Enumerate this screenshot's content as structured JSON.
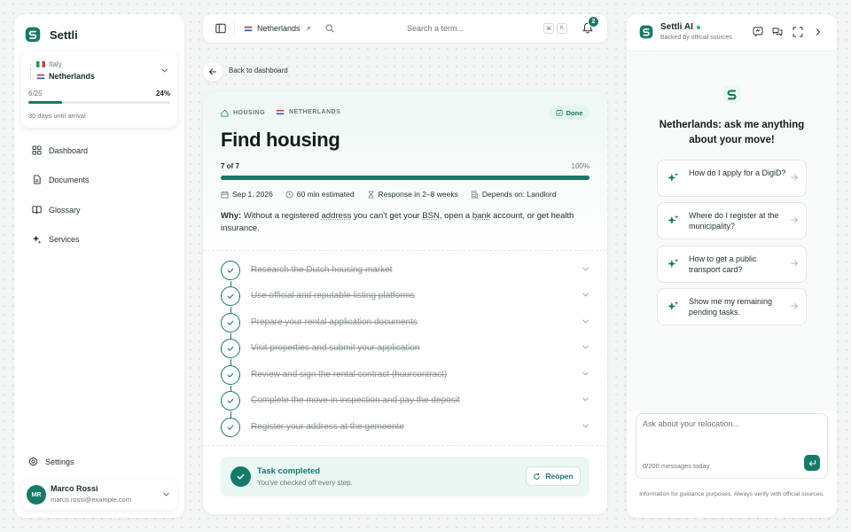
{
  "sidebar": {
    "brand": "Settli",
    "trip": {
      "origin": "Italy",
      "destination": "Netherlands",
      "progress_text": "6/25",
      "progress_percent": "24%",
      "progress_fraction": 0.24,
      "arrival_text": "30 days until arrival"
    },
    "nav": [
      {
        "label": "Dashboard"
      },
      {
        "label": "Documents"
      },
      {
        "label": "Glossary"
      },
      {
        "label": "Services"
      }
    ],
    "settings_label": "Settings",
    "user": {
      "initials": "MR",
      "name": "Marco Rossi",
      "email": "marco.rossi@example.com"
    }
  },
  "topbar": {
    "country": "Netherlands",
    "search_placeholder": "Search a term...",
    "kbd_mod": "⌘",
    "kbd_key": "K",
    "notification_count": "2"
  },
  "main": {
    "back_label": "Back to dashboard",
    "category": "HOUSING",
    "country": "NETHERLANDS",
    "status": "Done",
    "title": "Find housing",
    "progress_text": "7 of 7",
    "progress_percent": "100%",
    "progress_fraction": 1.0,
    "meta": {
      "date": "Sep 1, 2026",
      "duration": "60 min estimated",
      "response": "Response in 2–8 weeks",
      "depends": "Depends on: Landlord"
    },
    "why_label": "Why:",
    "why_text_1": "Without a registered",
    "why_link_1": "address",
    "why_text_2": "you can't get your",
    "why_link_2": "BSN",
    "why_text_3": ", open a",
    "why_link_3": "bank",
    "why_text_4": "account, or get health insurance.",
    "steps": [
      {
        "label": "Research the Dutch housing market"
      },
      {
        "label": "Use official and reputable listing platforms"
      },
      {
        "label": "Prepare your rental application documents"
      },
      {
        "label": "Visit properties and submit your application"
      },
      {
        "label": "Review and sign the rental contract (huurcontract)"
      },
      {
        "label": "Complete the move-in inspection and pay the deposit"
      },
      {
        "label": "Register your address at the gemeente"
      }
    ],
    "completed": {
      "title": "Task completed",
      "subtitle": "You've checked off every step.",
      "reopen_label": "Reopen"
    }
  },
  "ai": {
    "title": "Settli AI",
    "subtitle": "Backed by official sources",
    "heading": "Netherlands: ask me anything about your move!",
    "suggestions": [
      {
        "text": "How do I apply for a DigiD?"
      },
      {
        "text": "Where do I register at the municipality?"
      },
      {
        "text": "How to get a public transport card?"
      },
      {
        "text": "Show me my remaining pending tasks."
      }
    ],
    "input_placeholder": "Ask about your relocation...",
    "counter": "0/200 messages today",
    "disclaimer": "Information for guidance purposes. Always verify with official sources."
  },
  "colors": {
    "accent": "#167a69",
    "done_bg": "#e3f3ee",
    "completed_bg": "#eaf7f3",
    "online": "#22b07d",
    "badge": "#167a69"
  }
}
